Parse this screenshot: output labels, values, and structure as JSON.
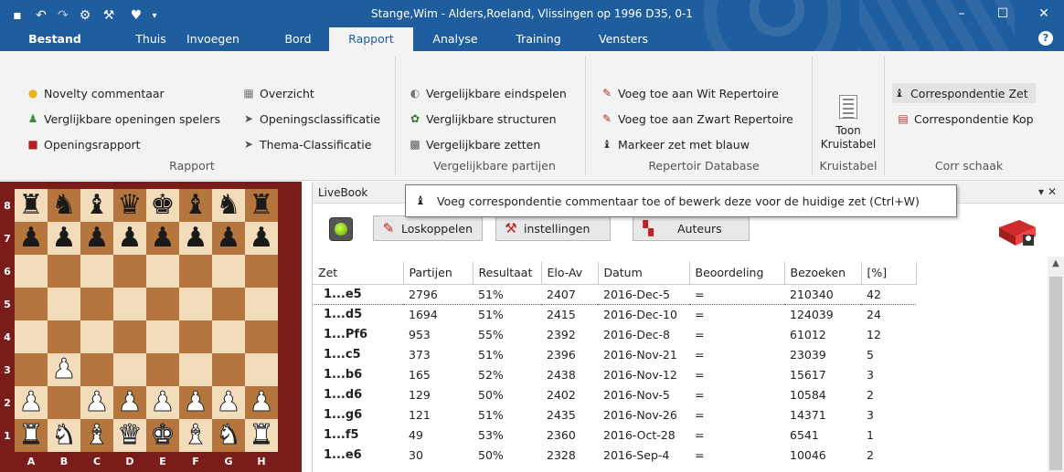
{
  "window": {
    "title": "Stange,Wim - Alders,Roeland, Vlissingen op 1996  D35, 0-1",
    "accent": "#1f5e9e"
  },
  "quick_access": [
    "save-icon",
    "undo-icon",
    "redo-icon",
    "engine-icon",
    "tools-icon",
    "bulb-icon",
    "dropdown-icon"
  ],
  "menu": {
    "items": [
      "Bestand",
      "Thuis",
      "Invoegen",
      "Bord",
      "Rapport",
      "Analyse",
      "Training",
      "Vensters"
    ],
    "active": "Rapport"
  },
  "ribbon": {
    "rapport": {
      "label": "Rapport",
      "items": [
        "Novelty commentaar",
        "Verglijkbare openingen spelers",
        "Openingsrapport",
        "Overzicht",
        "Openingsclassificatie",
        "Thema-Classificatie"
      ]
    },
    "vergelijkbare": {
      "label": "Vergelijkbare partijen",
      "items": [
        "Vergelijkbare eindspelen",
        "Verglijkbare structuren",
        "Vergelijkbare zetten"
      ]
    },
    "repertoire": {
      "label": "Repertoir Database",
      "items": [
        "Voeg toe aan Wit Repertoire",
        "Voeg toe aan Zwart Repertoire",
        "Markeer zet met blauw"
      ]
    },
    "kruistabel": {
      "label": "Kruistabel",
      "button": "Toon Kruistabel"
    },
    "corr": {
      "label": "Corr schaak",
      "items": [
        "Correspondentie Zet",
        "Correspondentie Kop"
      ]
    }
  },
  "board": {
    "ranks": [
      "8",
      "7",
      "6",
      "5",
      "4",
      "3",
      "2",
      "1"
    ],
    "files": [
      "A",
      "B",
      "C",
      "D",
      "E",
      "F",
      "G",
      "H"
    ],
    "position": [
      "rnbqkbnr",
      "pppppppp",
      "........",
      "........",
      "........",
      ".P......",
      "P.PPPPPP",
      "RNBQKBNR"
    ]
  },
  "livebook": {
    "title": "LiveBook",
    "buttons": [
      "Loskoppelen",
      "instellingen",
      "Auteurs"
    ],
    "columns": [
      "Zet",
      "Partijen",
      "Resultaat",
      "Elo-Av",
      "Datum",
      "Beoordeling",
      "Bezoeken",
      "[%]"
    ],
    "rows": [
      [
        "1...e5",
        "2796",
        "51%",
        "2407",
        "2016-Dec-5",
        "=",
        "210340",
        "42"
      ],
      [
        "1...d5",
        "1694",
        "51%",
        "2415",
        "2016-Dec-10",
        "=",
        "124039",
        "24"
      ],
      [
        "1...Pf6",
        "953",
        "55%",
        "2392",
        "2016-Dec-8",
        "=",
        "61012",
        "12"
      ],
      [
        "1...c5",
        "373",
        "51%",
        "2396",
        "2016-Nov-21",
        "=",
        "23039",
        "5"
      ],
      [
        "1...b6",
        "165",
        "52%",
        "2438",
        "2016-Nov-12",
        "=",
        "15617",
        "3"
      ],
      [
        "1...d6",
        "129",
        "50%",
        "2402",
        "2016-Nov-5",
        "=",
        "10584",
        "2"
      ],
      [
        "1...g6",
        "121",
        "51%",
        "2435",
        "2016-Nov-26",
        "=",
        "14371",
        "3"
      ],
      [
        "1...f5",
        "49",
        "53%",
        "2360",
        "2016-Oct-28",
        "=",
        "6541",
        "1"
      ],
      [
        "1...e6",
        "30",
        "50%",
        "2328",
        "2016-Sep-4",
        "=",
        "10046",
        "2"
      ]
    ]
  },
  "tooltip": {
    "text": "Voeg correspondentie commentaar toe of bewerk deze voor de huidige zet (Ctrl+W)"
  }
}
